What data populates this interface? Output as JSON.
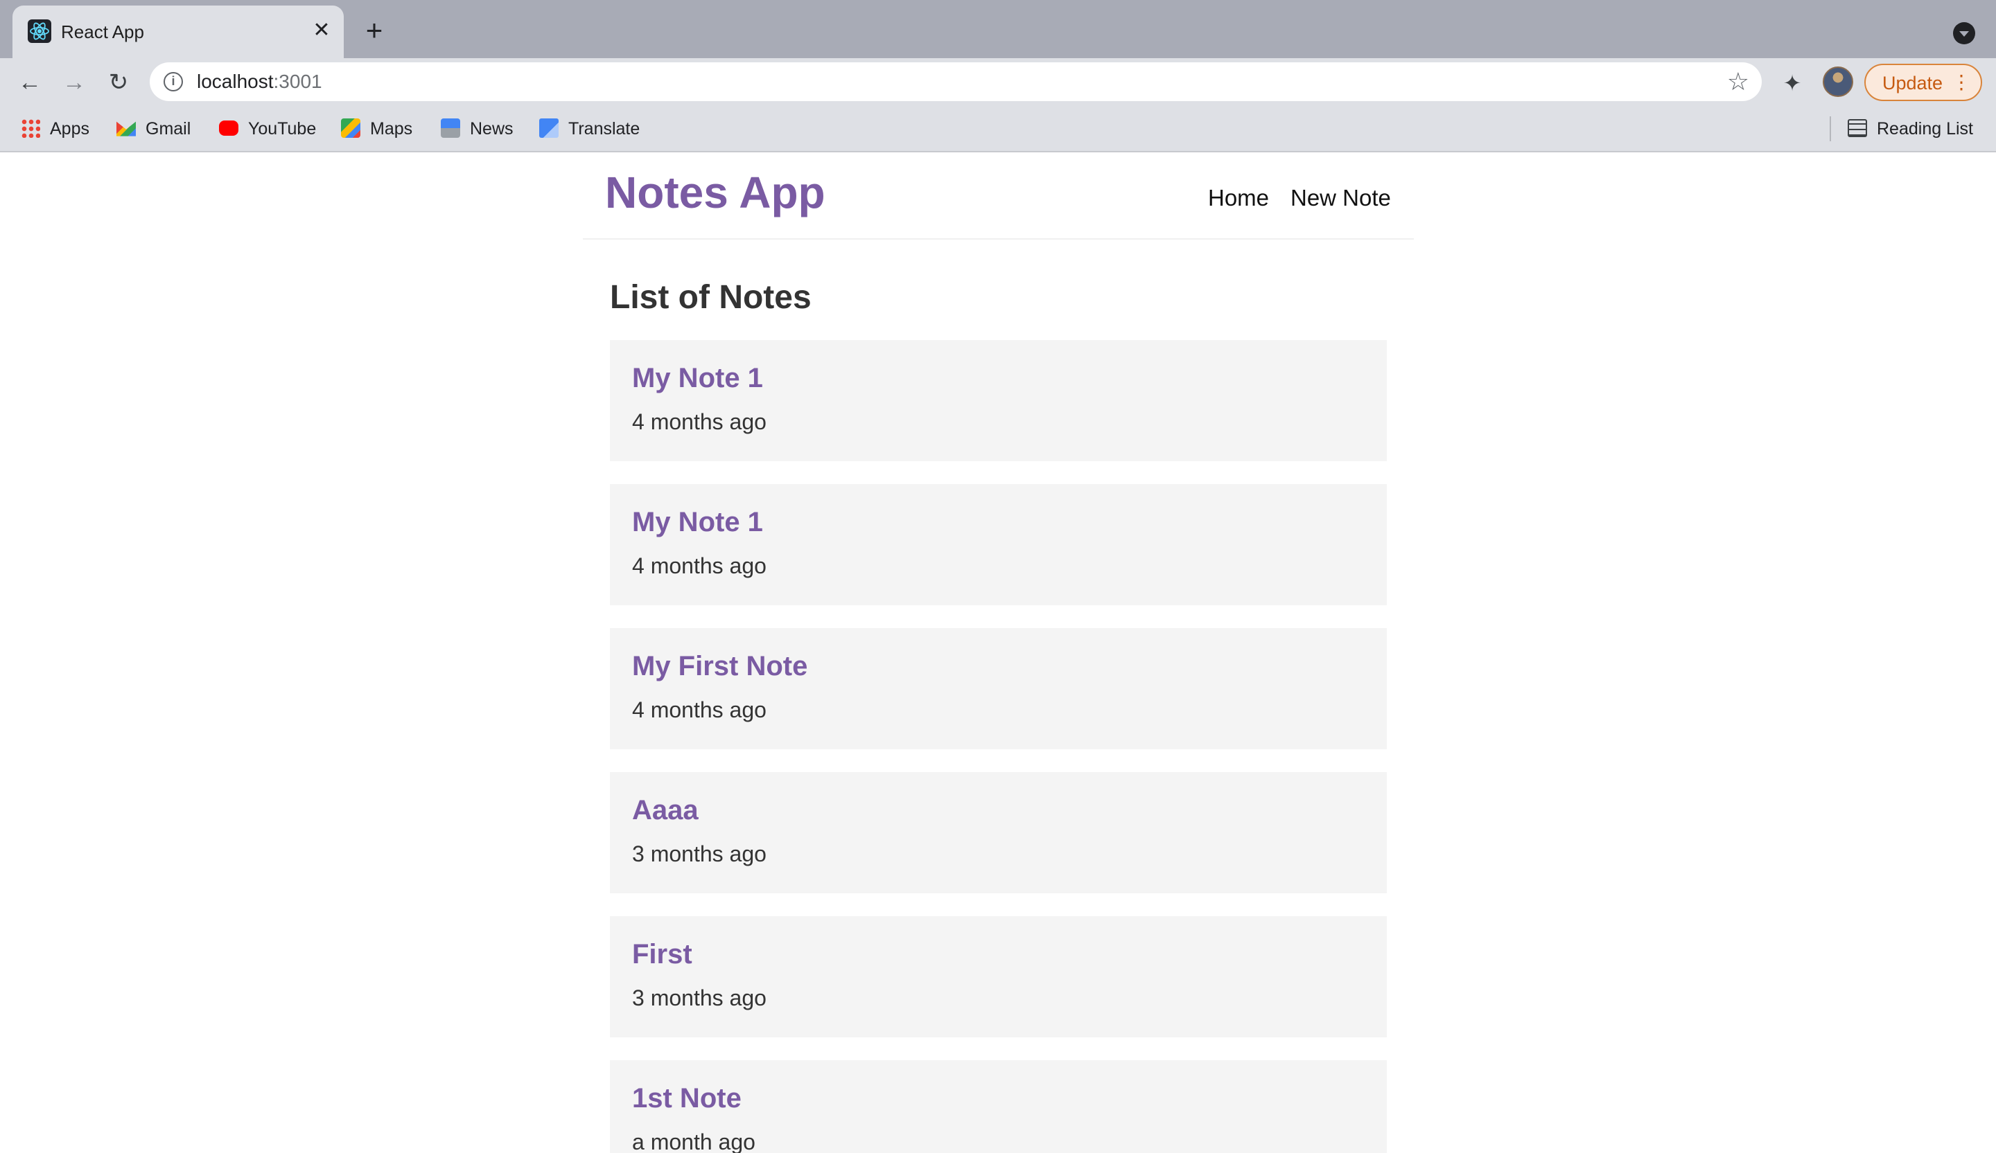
{
  "browser": {
    "tab_title": "React App",
    "tab_close": "✕",
    "new_tab": "+",
    "url_host": "localhost",
    "url_port": ":3001",
    "update_label": "Update",
    "bookmarks": [
      {
        "label": "Apps",
        "icon": "apps-grid-icon"
      },
      {
        "label": "Gmail",
        "icon": "gmail-icon"
      },
      {
        "label": "YouTube",
        "icon": "youtube-icon"
      },
      {
        "label": "Maps",
        "icon": "maps-icon"
      },
      {
        "label": "News",
        "icon": "news-icon"
      },
      {
        "label": "Translate",
        "icon": "translate-icon"
      }
    ],
    "reading_list": "Reading List"
  },
  "app": {
    "brand": "Notes App",
    "nav": {
      "home": "Home",
      "new_note": "New Note"
    },
    "heading": "List of Notes",
    "notes": [
      {
        "title": "My Note 1",
        "time": "4 months ago"
      },
      {
        "title": "My Note 1",
        "time": "4 months ago"
      },
      {
        "title": "My First Note",
        "time": "4 months ago"
      },
      {
        "title": "Aaaa",
        "time": "3 months ago"
      },
      {
        "title": "First",
        "time": "3 months ago"
      },
      {
        "title": "1st Note",
        "time": "a month ago"
      }
    ]
  },
  "colors": {
    "accent": "#7a5ba3",
    "card_bg": "#f4f4f4",
    "text": "#333333"
  }
}
